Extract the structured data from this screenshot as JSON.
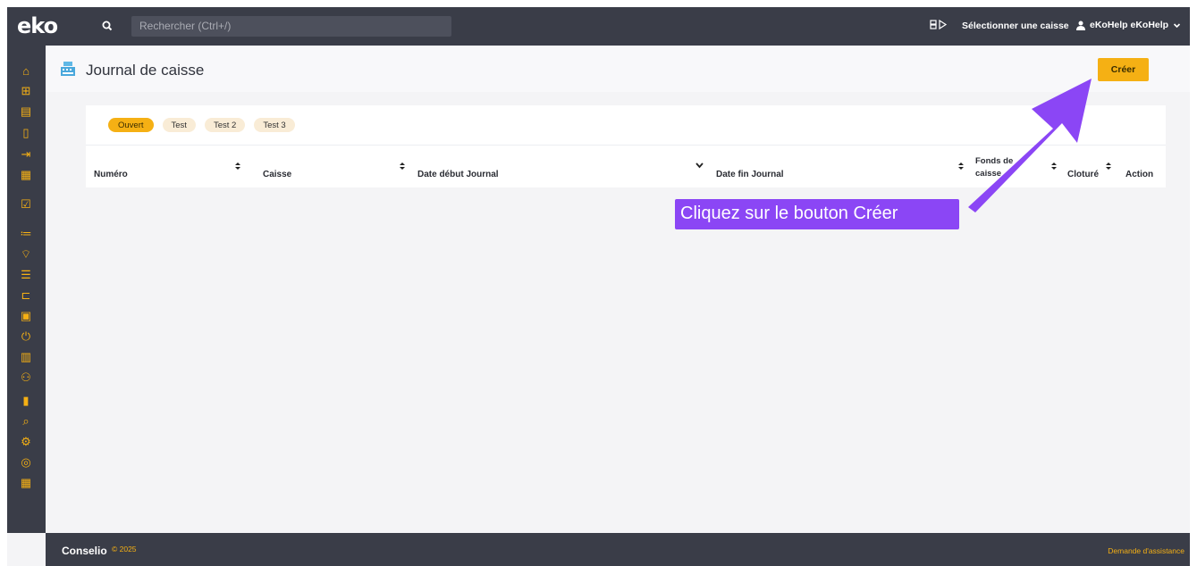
{
  "app": {
    "logo_text": "eko"
  },
  "topbar": {
    "search_placeholder": "Rechercher (Ctrl+/)",
    "select_cashier_label": "Sélectionner une caisse",
    "user_name": "eKoHelp eKoHelp"
  },
  "sidebar": {
    "items": [
      {
        "name": "home-icon",
        "glyph": "⌂"
      },
      {
        "name": "plus-square-icon",
        "glyph": "⊞"
      },
      {
        "name": "list-doc-icon",
        "glyph": "▤"
      },
      {
        "name": "file-icon",
        "glyph": "▯"
      },
      {
        "name": "file-export-icon",
        "glyph": "⇥"
      },
      {
        "name": "calendar-icon",
        "glyph": "▦"
      },
      {
        "name": "calendar-check-icon",
        "glyph": "☑"
      },
      {
        "name": "list-check-icon",
        "glyph": "≔"
      },
      {
        "name": "folder-open-icon",
        "glyph": "⌔"
      },
      {
        "name": "sort-list-icon",
        "glyph": "☰"
      },
      {
        "name": "hierarchy-icon",
        "glyph": "⊏"
      },
      {
        "name": "cash-register-icon",
        "glyph": "▣"
      },
      {
        "name": "power-icon",
        "glyph": "⏻"
      },
      {
        "name": "book-icon",
        "glyph": "▥"
      },
      {
        "name": "people-group-icon",
        "glyph": "⚇"
      },
      {
        "name": "bar-chart-icon",
        "glyph": "▮"
      },
      {
        "name": "magnifier-icon",
        "glyph": "⌕"
      },
      {
        "name": "gears-icon",
        "glyph": "⚙"
      },
      {
        "name": "palette-icon",
        "glyph": "◎"
      },
      {
        "name": "calculator-icon",
        "glyph": "▦"
      }
    ]
  },
  "page": {
    "title": "Journal de caisse",
    "create_label": "Créer"
  },
  "tabs": [
    "Ouvert",
    "Test",
    "Test 2",
    "Test 3"
  ],
  "table": {
    "columns": [
      "Numéro",
      "Caisse",
      "Date début Journal",
      "Date fin Journal",
      "Fonds de caisse",
      "Cloturé",
      "Action"
    ],
    "rows": []
  },
  "annotation": {
    "text": "Cliquez sur le bouton Créer"
  },
  "footer": {
    "brand": "Conselio",
    "year": "© 2025",
    "help_link": "Demande d'assistance"
  },
  "colors": {
    "accent": "#f5b014",
    "dark": "#3a3d48",
    "annotation": "#8b46f5"
  }
}
